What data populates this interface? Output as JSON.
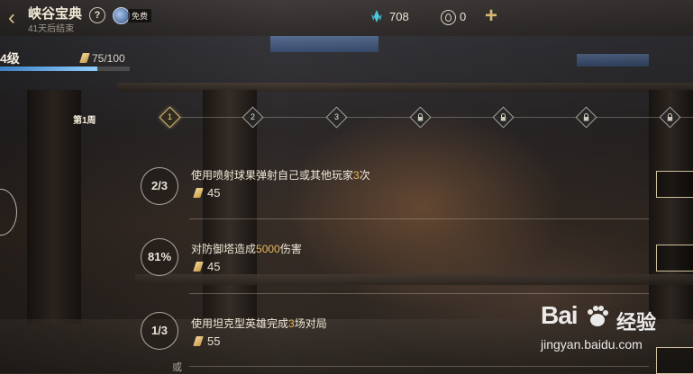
{
  "header": {
    "title": "峡谷宝典",
    "subtitle": "41天后结束",
    "help": "?",
    "free_badge": "免费",
    "gem_count": "708",
    "coin_count": "0"
  },
  "level": {
    "label": "4级",
    "progress_text": "75/100",
    "progress_value": 0.75
  },
  "timeline": {
    "week_label": "第1周",
    "nodes": [
      {
        "label": "1",
        "state": "active"
      },
      {
        "label": "2",
        "state": "unlocked"
      },
      {
        "label": "3",
        "state": "unlocked"
      },
      {
        "label": "",
        "state": "locked"
      },
      {
        "label": "",
        "state": "locked"
      },
      {
        "label": "",
        "state": "locked"
      },
      {
        "label": "",
        "state": "locked"
      }
    ]
  },
  "tasks": [
    {
      "badge": "2/3",
      "desc_pre": "使用喷射球果弹射自己或其他玩家",
      "desc_hl": "3",
      "desc_post": "次",
      "reward": "45"
    },
    {
      "badge": "81%",
      "desc_pre": "对防御塔造成",
      "desc_hl": "5000",
      "desc_post": "伤害",
      "reward": "45"
    },
    {
      "badge": "1/3",
      "desc_pre": "使用坦克型英雄完成",
      "desc_hl": "3",
      "desc_post": "场对局",
      "reward": "55"
    }
  ],
  "or_text": "或",
  "watermark": {
    "logo": "Bai",
    "brand": "经验",
    "url": "jingyan.baidu.com"
  },
  "colors": {
    "accent_gold": "#d9be77",
    "highlight": "#e8b95a",
    "gem": "#4cc9d8",
    "progress": "#5aa8e8"
  }
}
